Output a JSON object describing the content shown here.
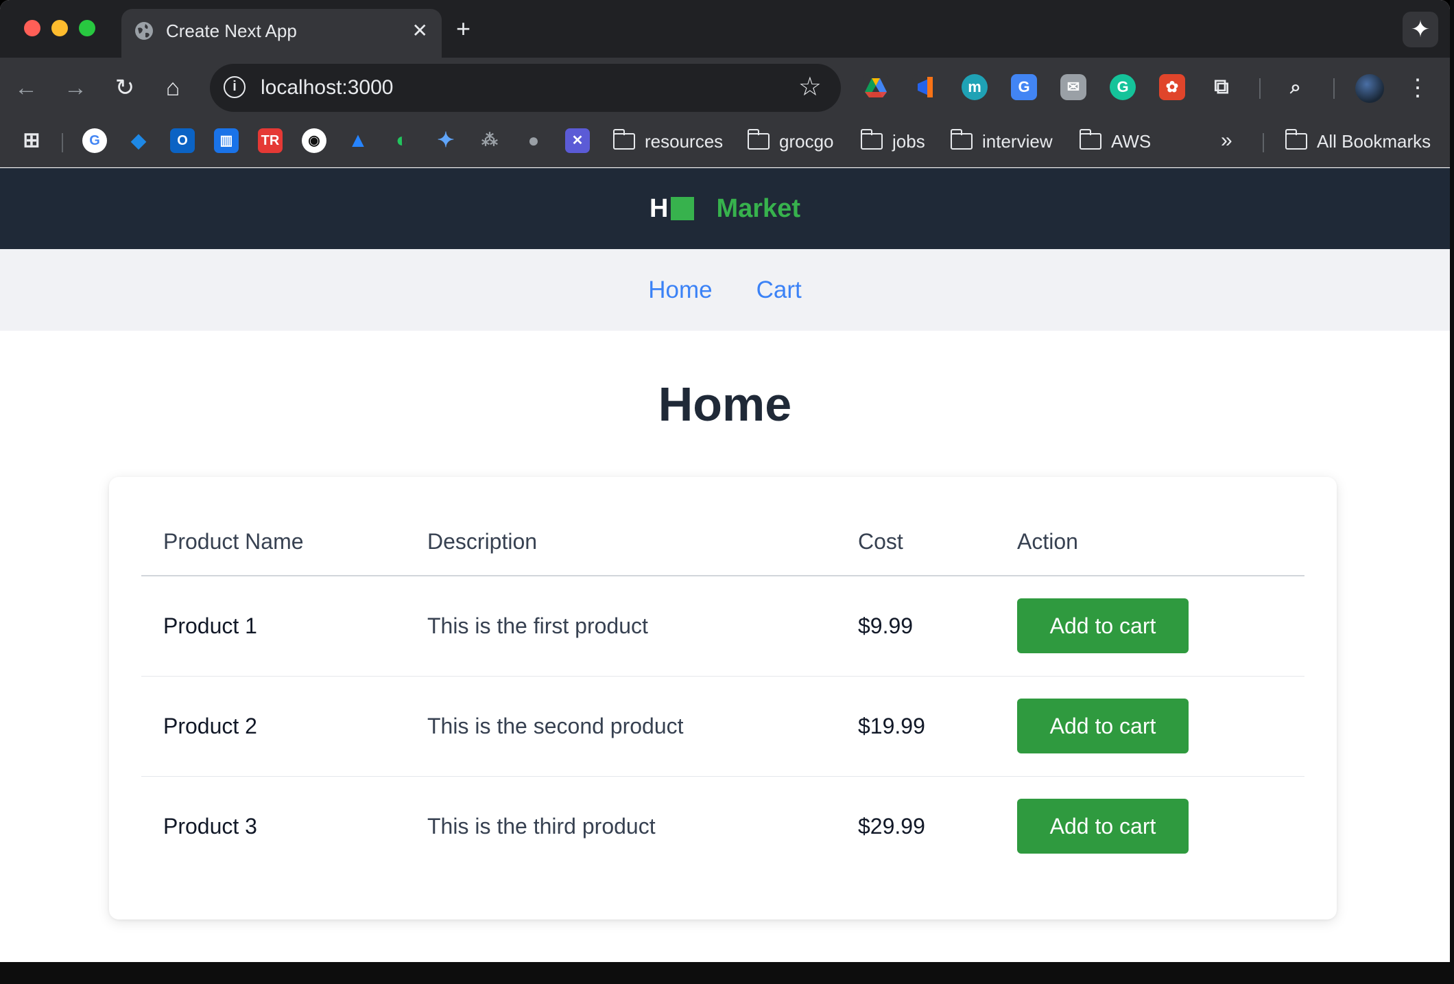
{
  "browser": {
    "tab_title": "Create Next App",
    "tab_close": "✕",
    "new_tab": "+",
    "url": "localhost:3000",
    "bookmark_folders": [
      "resources",
      "grocgo",
      "jobs",
      "interview",
      "AWS"
    ],
    "all_bookmarks": "All Bookmarks",
    "more": "»"
  },
  "site": {
    "brand_letter": "H",
    "brand_name": "Market",
    "brand_color": "#37b24d",
    "nav": [
      "Home",
      "Cart"
    ],
    "link_color": "#3b82f6"
  },
  "main": {
    "title": "Home",
    "table": {
      "headers": [
        "Product Name",
        "Description",
        "Cost",
        "Action"
      ],
      "rows": [
        {
          "name": "Product 1",
          "description": "This is the first product",
          "cost": "$9.99",
          "action": "Add to cart"
        },
        {
          "name": "Product 2",
          "description": "This is the second product",
          "cost": "$19.99",
          "action": "Add to cart"
        },
        {
          "name": "Product 3",
          "description": "This is the third product",
          "cost": "$29.99",
          "action": "Add to cart"
        }
      ]
    },
    "button_color": "#2f9a3f"
  }
}
